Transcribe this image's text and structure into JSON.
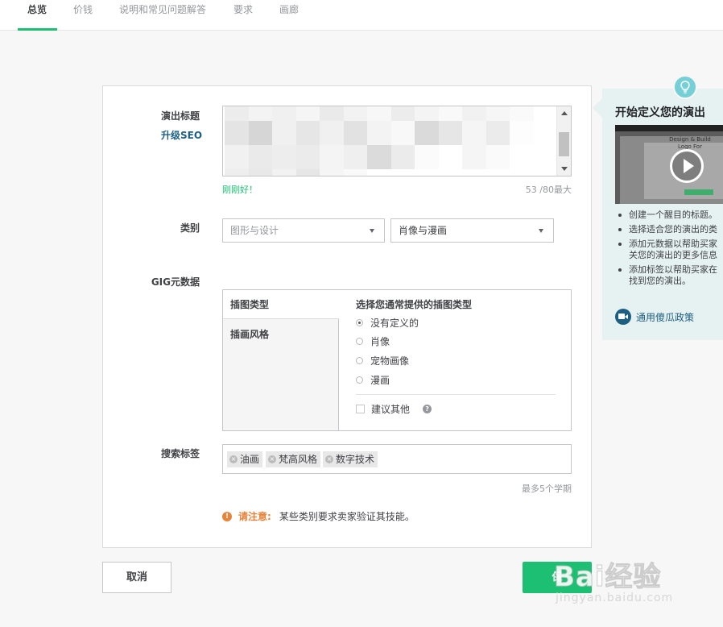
{
  "nav": {
    "tabs": [
      {
        "label": "总览",
        "active": true
      },
      {
        "label": "价钱",
        "active": false
      },
      {
        "label": "说明和常见问题解答",
        "active": false
      },
      {
        "label": "要求",
        "active": false
      },
      {
        "label": "画廊",
        "active": false
      }
    ]
  },
  "form": {
    "title": {
      "label": "演出标题",
      "seo_link": "升级SEO",
      "feedback": "刚刚好！",
      "counter": "53 /80最大"
    },
    "category": {
      "label": "类别",
      "primary_value": "图形与设计",
      "secondary_value": "肖像与漫画"
    },
    "metadata": {
      "label": "GIG元数据",
      "tabs": [
        "插图类型",
        "插画风格"
      ],
      "heading": "选择您通常提供的插图类型",
      "options": [
        {
          "label": "没有定义的",
          "selected": true
        },
        {
          "label": "肖像",
          "selected": false
        },
        {
          "label": "宠物画像",
          "selected": false
        },
        {
          "label": "漫画",
          "selected": false
        }
      ],
      "suggest_label": "建议其他",
      "help_icon": "question-circle-icon"
    },
    "tags": {
      "label": "搜索标签",
      "items": [
        "油画",
        "梵高风格",
        "数字技术"
      ],
      "hint": "最多5个学期"
    },
    "notice": {
      "icon": "info-icon",
      "strong": "请注意:",
      "text": "某些类别要求卖家验证其技能。"
    }
  },
  "actions": {
    "cancel_label": "取消",
    "save_label": "保"
  },
  "sidebar": {
    "icon": "lightbulb-icon",
    "title": "开始定义您的演出",
    "video_caption": "Design & Build Logo For",
    "tips": [
      "创建一个醒目的标题。",
      "选择适合您的演出的类",
      "添加元数据以帮助买家",
      "关您的演出的更多信息",
      "添加标签以帮助买家在",
      "找到您的演出。"
    ],
    "policy_link": "通用傻瓜政策"
  },
  "watermark": {
    "brand": "Bai经验",
    "url": "jingyan.baidu.com"
  },
  "colors": {
    "accent": "#1dbf73",
    "link": "#1d5f82",
    "warning": "#e8833a",
    "sidebar_bg": "#e6f2f2",
    "bulb": "#74cfd7"
  }
}
